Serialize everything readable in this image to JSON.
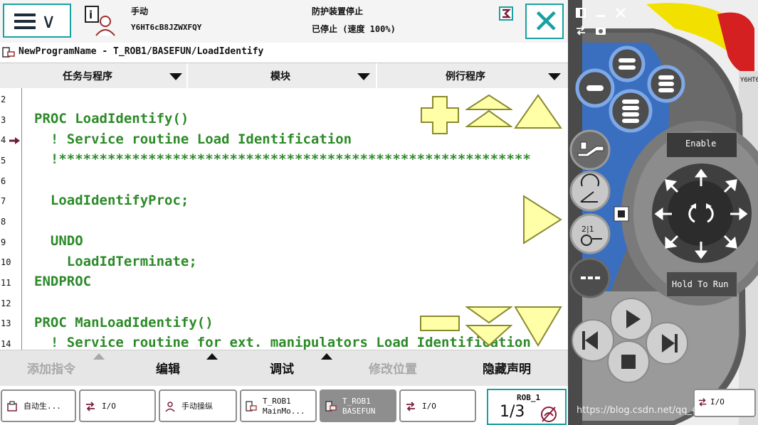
{
  "status": {
    "mode": "手动",
    "controller_id": "Y6HT6cB8JZWXFQY",
    "guard_state": "防护装置停止",
    "run_state": "已停止 (速度 100%)"
  },
  "path": "NewProgramName - T_ROB1/BASEFUN/LoadIdentify",
  "tabs": [
    {
      "label": "任务与程序"
    },
    {
      "label": "模块"
    },
    {
      "label": "例行程序"
    }
  ],
  "code": {
    "line_numbers": [
      "2",
      "3",
      "4",
      "5",
      "6",
      "7",
      "8",
      "9",
      "10",
      "11",
      "12",
      "13",
      "14"
    ],
    "current_line": "4",
    "lines": [
      "",
      "PROC LoadIdentify()",
      "  ! Service routine Load Identification",
      "  !**********************************************************",
      "",
      "  LoadIdentifyProc;",
      "",
      "  UNDO",
      "    LoadIdTerminate;",
      "ENDPROC",
      "",
      "PROC ManLoadIdentify()",
      "  ! Service routine for ext. manipulators Load Identification"
    ]
  },
  "bottom_bar": [
    {
      "label": "添加指令",
      "enabled": false
    },
    {
      "label": "编辑",
      "enabled": true
    },
    {
      "label": "调试",
      "enabled": true
    },
    {
      "label": "修改位置",
      "enabled": false
    },
    {
      "label": "隐藏声明",
      "enabled": true
    }
  ],
  "taskbar": [
    {
      "line1": "自动生...",
      "line2": ""
    },
    {
      "line1": "I/O",
      "line2": ""
    },
    {
      "line1": "手动操纵",
      "line2": ""
    },
    {
      "line1": "T_ROB1",
      "line2": "MainMo..."
    },
    {
      "line1": "T_ROB1",
      "line2": "BASEFUN"
    },
    {
      "line1": "I/O",
      "line2": ""
    }
  ],
  "rob_box": {
    "title": "ROB_1",
    "fraction": "1/3"
  },
  "pendant": {
    "enable_label": "Enable",
    "hold_label": "Hold To Run",
    "partial_label": "Y6HT6c",
    "partial_io": "I/O"
  },
  "watermark": "https://blog.csdn.net/qq_42033009",
  "colors": {
    "teal": "#1aa0a0",
    "code_green": "#2c8a28",
    "pendant_blue": "#3a6fbf",
    "pendant_body": "#5a5a5a",
    "pendant_yellow": "#f2e100",
    "estop_red": "#d42020",
    "overlay_yellow": "#ffffa8"
  }
}
